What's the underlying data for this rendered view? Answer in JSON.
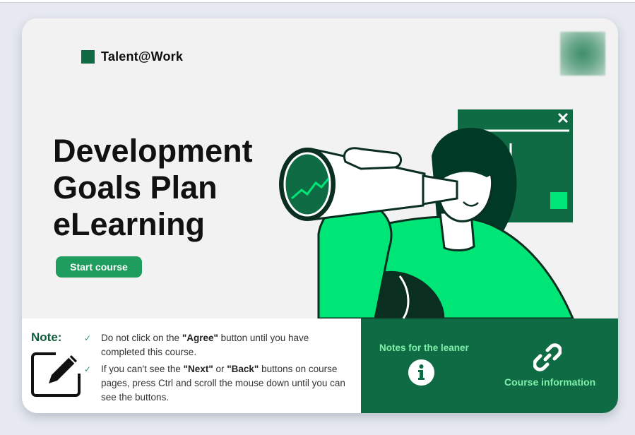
{
  "brand": {
    "name": "Talent@Work"
  },
  "hero": {
    "title_lines": [
      "Development",
      "Goals Plan",
      "eLearning"
    ],
    "start_button": "Start course"
  },
  "note": {
    "title": "Note:",
    "items": [
      {
        "pre": "Do not click on the ",
        "bold": "\"Agree\"",
        "post": " button until you have completed this course."
      },
      {
        "pre": "If you can't see the ",
        "bold1": "\"Next\"",
        "mid": " or ",
        "bold2": "\"Back\"",
        "post": " buttons on course pages, press Ctrl and scroll the mouse down until you can see the buttons."
      }
    ]
  },
  "links": {
    "notes_for_learner": "Notes for the leaner",
    "course_information": "Course information"
  },
  "colors": {
    "brand_dark_green": "#0f6b43",
    "button_green": "#1f9d5f",
    "bright_green": "#00e676",
    "label_green": "#7ff0a9"
  },
  "icons": {
    "note": "pencil-edit-icon",
    "info": "info-icon",
    "link": "link-icon",
    "close": "close-icon"
  }
}
